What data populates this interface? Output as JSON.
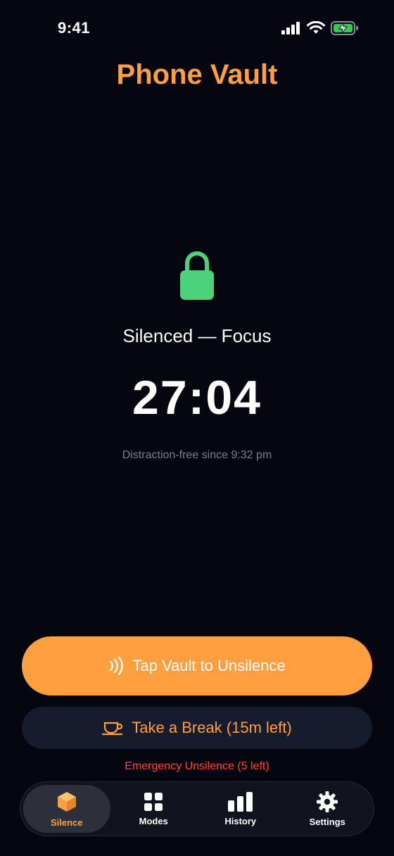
{
  "status_bar": {
    "time": "9:41"
  },
  "header": {
    "title": "Phone Vault"
  },
  "main": {
    "status_label": "Silenced — Focus",
    "timer": "27:04",
    "since_text": "Distraction-free since 9:32 pm"
  },
  "actions": {
    "primary_label": "Tap Vault to Unsilence",
    "secondary_label": "Take a Break (15m left)",
    "emergency_label": "Emergency Unsilence (5 left)"
  },
  "tabs": [
    {
      "label": "Silence",
      "icon": "cube-icon",
      "active": true
    },
    {
      "label": "Modes",
      "icon": "grid-icon",
      "active": false
    },
    {
      "label": "History",
      "icon": "bar-chart-icon",
      "active": false
    },
    {
      "label": "Settings",
      "icon": "gear-icon",
      "active": false
    }
  ],
  "colors": {
    "background": "#05060f",
    "accent": "#ff9f40",
    "lock": "#4cd27a",
    "danger": "#ff453a",
    "muted": "#7b7f8f"
  }
}
